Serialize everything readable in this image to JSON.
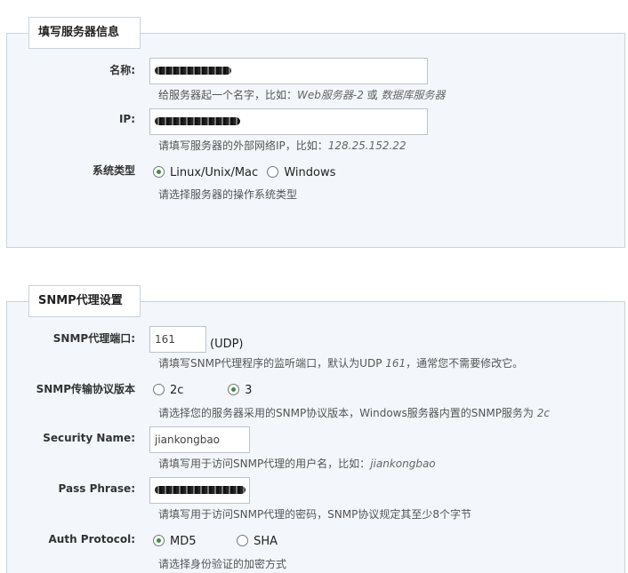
{
  "server_section": {
    "title": "填写服务器信息",
    "name": {
      "label": "名称:",
      "hint_prefix": "给服务器起一个名字，比如：",
      "hint_example1": "Web服务器-2",
      "hint_mid": " 或 ",
      "hint_example2": "数据库服务器"
    },
    "ip": {
      "label": "IP:",
      "hint_prefix": "请填写服务器的外部网络IP，比如：",
      "hint_example": "128.25.152.22"
    },
    "os_type": {
      "label": "系统类型",
      "options": [
        "Linux/Unix/Mac",
        "Windows"
      ],
      "selected": "Linux/Unix/Mac",
      "hint": "请选择服务器的操作系统类型"
    }
  },
  "snmp_section": {
    "title": "SNMP代理设置",
    "port": {
      "label": "SNMP代理端口:",
      "value": "161",
      "suffix": "(UDP)",
      "hint_prefix": "请填写SNMP代理程序的监听端口，默认为UDP ",
      "hint_example": "161",
      "hint_suffix": "，通常您不需要修改它。"
    },
    "version": {
      "label": "SNMP传输协议版本",
      "options": [
        "2c",
        "3"
      ],
      "selected": "3",
      "hint_prefix": "请选择您的服务器采用的SNMP协议版本，Windows服务器内置的SNMP服务为 ",
      "hint_example": "2c"
    },
    "security_name": {
      "label": "Security Name:",
      "value": "jiankongbao",
      "hint_prefix": "请填写用于访问SNMP代理的用户名，比如：",
      "hint_example": "jiankongbao"
    },
    "pass_phrase": {
      "label": "Pass Phrase:",
      "hint": "请填写用于访问SNMP代理的密码，SNMP协议规定其至少8个字节"
    },
    "auth_protocol": {
      "label": "Auth Protocol:",
      "options": [
        "MD5",
        "SHA"
      ],
      "selected": "MD5",
      "hint": "请选择身份验证的加密方式"
    }
  }
}
